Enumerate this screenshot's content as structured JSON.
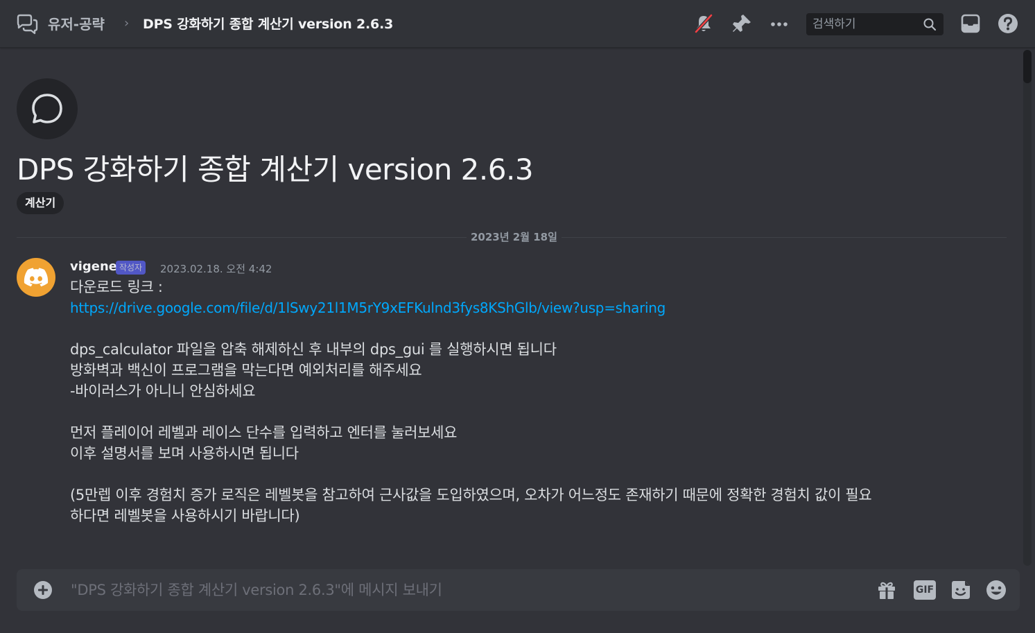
{
  "header": {
    "parent_channel": "유저-공략",
    "separator": "›",
    "thread_title": "DPS 강화하기 종합 계산기 version 2.6.3",
    "search_placeholder": "검색하기",
    "icons": [
      "threads-icon",
      "bell-slash-icon",
      "pin-icon",
      "more-icon",
      "search-icon",
      "inbox-icon",
      "help-icon"
    ]
  },
  "thread": {
    "title": "DPS 강화하기 종합 계산기 version 2.6.3",
    "tag": "계산기",
    "icon": "chat-bubble-icon"
  },
  "date_divider": "2023년 2월 18일",
  "message": {
    "author": "vigene",
    "badge": "작성자",
    "timestamp": "2023.02.18. 오전 4:42",
    "avatar_color": "#f0a232",
    "lines": {
      "l1": "다운로드 링크 :",
      "link": "https://drive.google.com/file/d/1lSwy21l1M5rY9xEFKulnd3fys8KShGlb/view?usp=sharing",
      "l3": "dps_calculator 파일을 압축 해제하신 후 내부의 dps_gui 를 실행하시면 됩니다",
      "l4": "방화벽과 백신이 프로그램을 막는다면 예외처리를 해주세요",
      "l5": "-바이러스가 아니니 안심하세요",
      "l6": "먼저 플레이어 레벨과 레이스 단수를 입력하고 엔터를 눌러보세요",
      "l7": "이후 설명서를 보며 사용하시면 됩니다",
      "l8": "(5만렙 이후 경험치 증가 로직은 레벨봇을 참고하여 근사값을 도입하였으며, 오차가 어느정도 존재하기 때문에 정확한 경험치 값이 필요",
      "l9": "하다면 레벨봇을 사용하시기 바랍니다)"
    }
  },
  "composer": {
    "placeholder": "\"DPS 강화하기 종합 계산기 version 2.6.3\"에 메시지 보내기",
    "icons": [
      "add-circle-icon",
      "gift-icon",
      "gif-icon",
      "sticker-icon",
      "emoji-icon"
    ],
    "gif_label": "GIF"
  },
  "colors": {
    "background": "#323339",
    "link": "#00a8fc",
    "accent": "#5c64f4",
    "mute_red": "#f23f43"
  }
}
